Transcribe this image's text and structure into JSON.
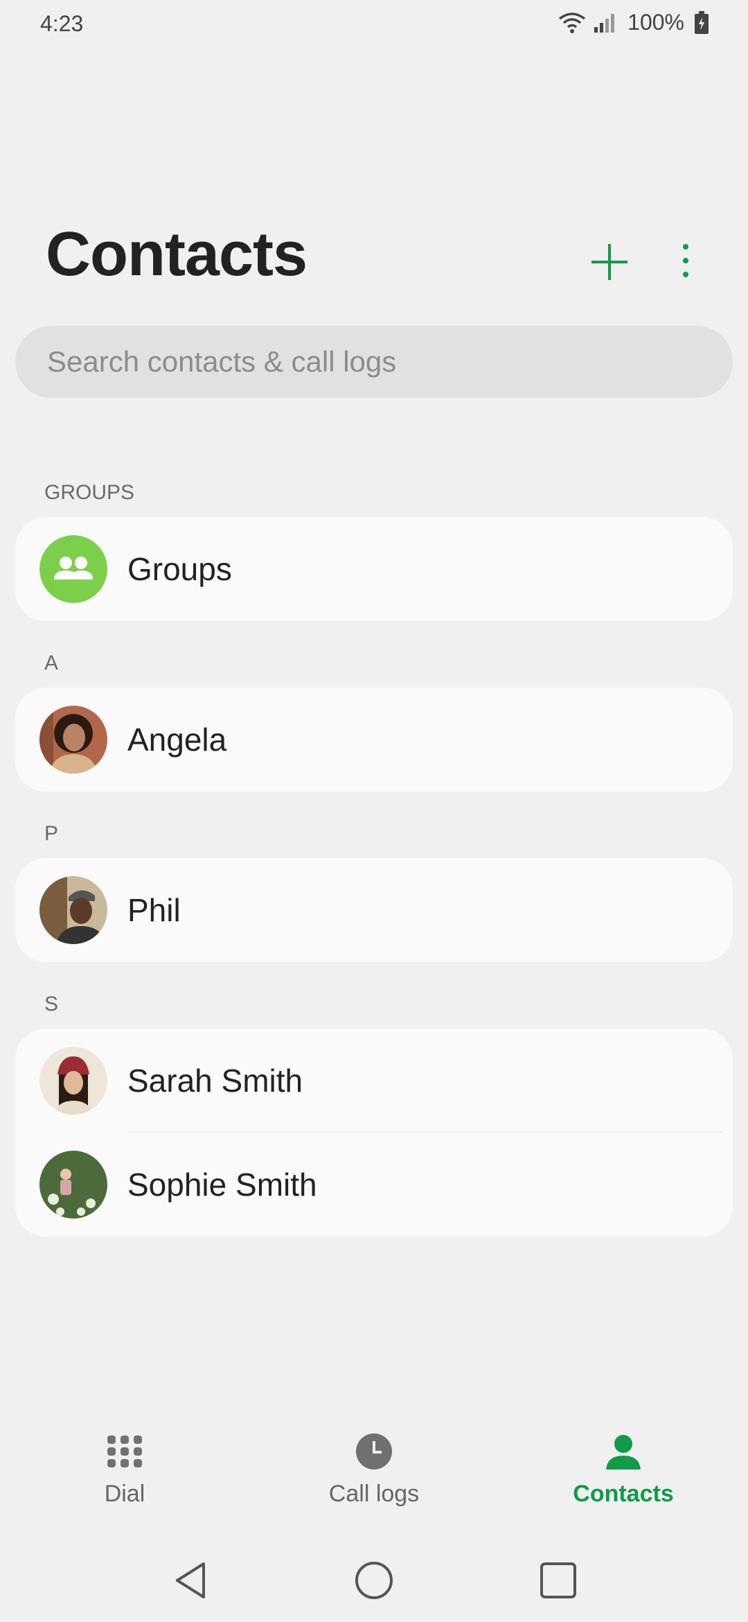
{
  "status_bar": {
    "time": "4:23",
    "battery": "100%"
  },
  "header": {
    "title": "Contacts"
  },
  "search": {
    "placeholder": "Search contacts & call logs"
  },
  "colors": {
    "accent": "#0f9b47",
    "groups_avatar": "#7ccf4a"
  },
  "sections": [
    {
      "label": "GROUPS",
      "items": [
        {
          "name": "Groups",
          "icon": "people-icon"
        }
      ]
    },
    {
      "label": "A",
      "items": [
        {
          "name": "Angela"
        }
      ]
    },
    {
      "label": "P",
      "items": [
        {
          "name": "Phil"
        }
      ]
    },
    {
      "label": "S",
      "items": [
        {
          "name": "Sarah Smith"
        },
        {
          "name": "Sophie Smith"
        }
      ]
    }
  ],
  "tabs": [
    {
      "label": "Dial",
      "icon": "dialpad-icon"
    },
    {
      "label": "Call logs",
      "icon": "clock-icon"
    },
    {
      "label": "Contacts",
      "icon": "person-icon",
      "active": true
    }
  ],
  "nav": [
    "back-icon",
    "home-icon",
    "recents-icon"
  ]
}
